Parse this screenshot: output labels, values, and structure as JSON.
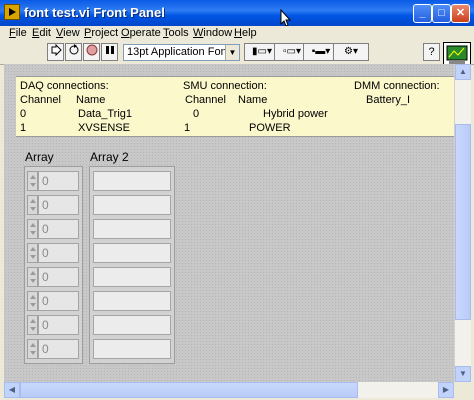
{
  "window": {
    "title": "font test.vi Front Panel"
  },
  "menu": [
    "File",
    "Edit",
    "View",
    "Project",
    "Operate",
    "Tools",
    "Window",
    "Help"
  ],
  "toolbar": {
    "font": "13pt Application Font"
  },
  "info": {
    "daq_header": "DAQ connections:",
    "smu_header": "SMU connection:",
    "dmm_header": "DMM connection:",
    "col_channel": "Channel",
    "col_name": "Name",
    "smu_channel": "Channel",
    "smu_name": "Name",
    "dmm_name": "Battery_I",
    "rows": [
      {
        "daq_ch": "0",
        "daq_name": "Data_Trig1",
        "smu_ch": "0",
        "smu_name": "Hybrid power"
      },
      {
        "daq_ch": "1",
        "daq_name": "XVSENSE",
        "smu_ch": "1",
        "smu_name": "POWER"
      }
    ]
  },
  "arrays": {
    "array1_label": "Array",
    "array2_label": "Array 2",
    "array1_values": [
      "0",
      "0",
      "0",
      "0",
      "0",
      "0",
      "0",
      "0"
    ]
  }
}
